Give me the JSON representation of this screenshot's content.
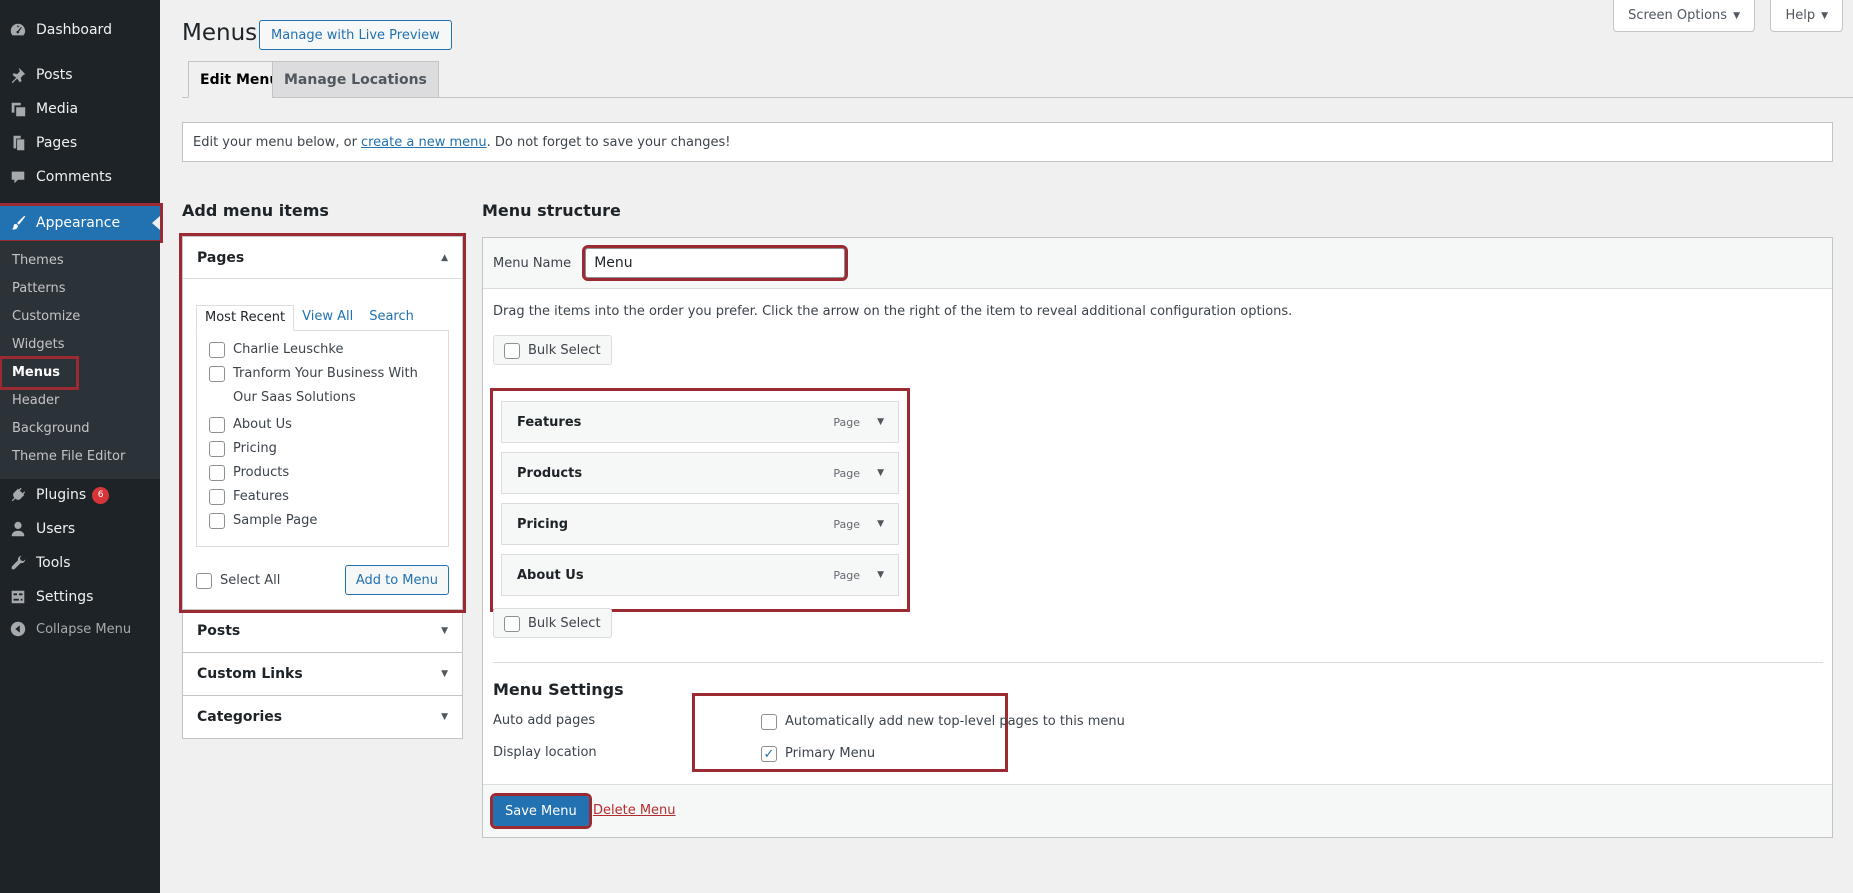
{
  "sidebar": {
    "items": [
      {
        "label": "Dashboard",
        "icon": "dashboard-icon"
      },
      {
        "label": "Posts",
        "icon": "pin-icon"
      },
      {
        "label": "Media",
        "icon": "media-icon"
      },
      {
        "label": "Pages",
        "icon": "page-icon"
      },
      {
        "label": "Comments",
        "icon": "comment-icon"
      },
      {
        "label": "Appearance",
        "icon": "brush-icon"
      },
      {
        "label": "Plugins",
        "icon": "plugin-icon",
        "badge": "6"
      },
      {
        "label": "Users",
        "icon": "user-icon"
      },
      {
        "label": "Tools",
        "icon": "wrench-icon"
      },
      {
        "label": "Settings",
        "icon": "settings-icon"
      },
      {
        "label": "Collapse Menu",
        "icon": "collapse-icon"
      }
    ],
    "submenu": [
      "Themes",
      "Patterns",
      "Customize",
      "Widgets",
      "Menus",
      "Header",
      "Background",
      "Theme File Editor"
    ],
    "accent": "#2271b1"
  },
  "header": {
    "title": "Menus",
    "live_preview": "Manage with Live Preview",
    "screen_options": "Screen Options",
    "help": "Help",
    "tabs": [
      "Edit Menus",
      "Manage Locations"
    ]
  },
  "notice": {
    "before": "Edit your menu below, or",
    "link": "create a new menu",
    "after": ". Do not forget to save your changes!"
  },
  "add_items": {
    "heading": "Add menu items",
    "pages": {
      "title": "Pages",
      "tabs": [
        "Most Recent",
        "View All",
        "Search"
      ],
      "list": [
        "Charlie Leuschke",
        "Tranform Your Business With Our Saas Solutions",
        "About Us",
        "Pricing",
        "Products",
        "Features",
        "Sample Page"
      ],
      "select_all": "Select All",
      "add_button": "Add to Menu"
    },
    "sections": [
      "Posts",
      "Custom Links",
      "Categories"
    ]
  },
  "structure": {
    "heading": "Menu structure",
    "menu_name_label": "Menu Name",
    "menu_name_value": "Menu",
    "drag_hint": "Drag the items into the order you prefer. Click the arrow on the right of the item to reveal additional configuration options.",
    "bulk_select": "Bulk Select",
    "items": [
      {
        "title": "Features",
        "type": "Page"
      },
      {
        "title": "Products",
        "type": "Page"
      },
      {
        "title": "Pricing",
        "type": "Page"
      },
      {
        "title": "About Us",
        "type": "Page"
      }
    ],
    "settings": {
      "heading": "Menu Settings",
      "auto_add_label": "Auto add pages",
      "auto_add_option": "Automatically add new top-level pages to this menu",
      "auto_add_checked": false,
      "location_label": "Display location",
      "location_option": "Primary Menu",
      "location_checked": true
    },
    "save_button": "Save Menu",
    "delete_link": "Delete Menu"
  },
  "colors": {
    "highlight": "#9b2a33",
    "danger": "#b32d2e",
    "badge": "#d63638"
  }
}
